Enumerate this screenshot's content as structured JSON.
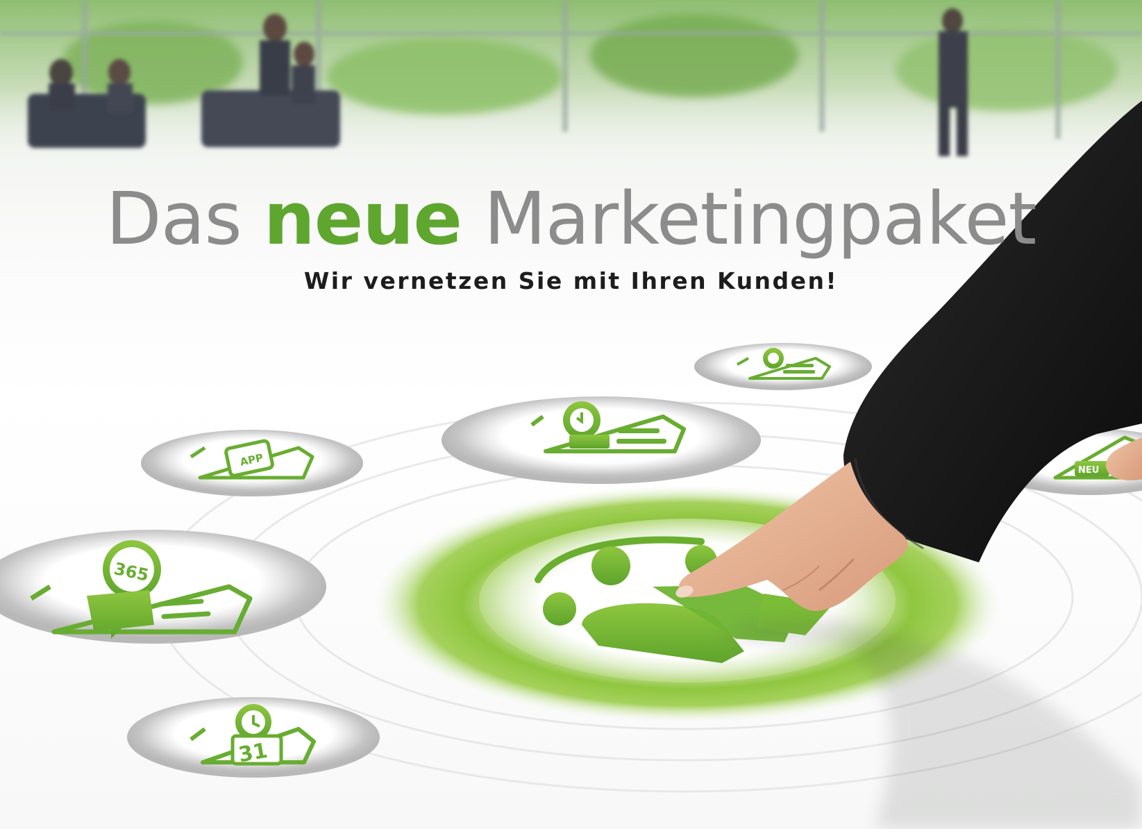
{
  "hero": {
    "title_part1": "Das",
    "title_accent": "neue",
    "title_part2": "Marketingpaket",
    "subtitle": "Wir vernetzen Sie mit Ihren Kunden!"
  },
  "colors": {
    "accent_green": "#5fa62e",
    "title_grey": "#8c8c8c",
    "subtitle_dark": "#1d1d1d",
    "sleeve_black": "#141414",
    "skin": "#e8b597"
  },
  "badges": [
    {
      "icon": "app-phone-icon",
      "text": "APP"
    },
    {
      "icon": "mobile-website-icon"
    },
    {
      "icon": "search-list-icon"
    },
    {
      "icon": "365-chat-icon",
      "text": "365"
    },
    {
      "icon": "calendar-31-icon",
      "text": "31"
    },
    {
      "icon": "community-people-icon"
    },
    {
      "icon": "news-icon",
      "text": "NEU"
    }
  ]
}
